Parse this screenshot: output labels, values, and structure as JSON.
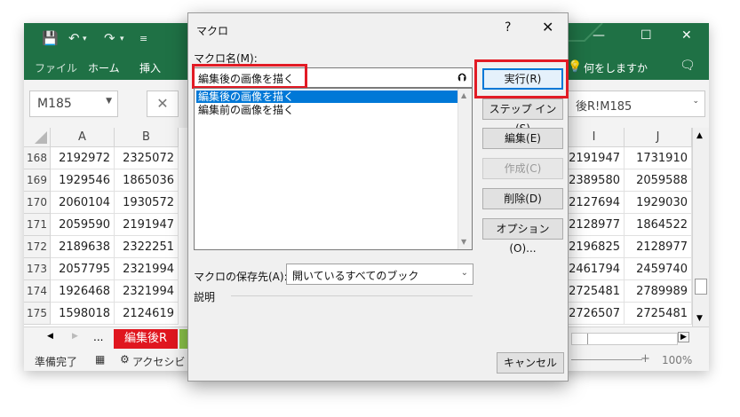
{
  "excel": {
    "ribbon_tabs": [
      "ファイル",
      "ホーム",
      "挿入"
    ],
    "tell_me": "何をしますか",
    "name_box": "M185",
    "formula_value": "後R!M185",
    "columns": [
      "A",
      "B",
      "I",
      "J"
    ],
    "rows": [
      {
        "num": "168",
        "a": "2192972",
        "b": "2325072",
        "i": "2191947",
        "j": "1731910"
      },
      {
        "num": "169",
        "a": "1929546",
        "b": "1865036",
        "i": "2389580",
        "j": "2059588"
      },
      {
        "num": "170",
        "a": "2060104",
        "b": "1930572",
        "i": "2127694",
        "j": "1929030"
      },
      {
        "num": "171",
        "a": "2059590",
        "b": "2191947",
        "i": "2128977",
        "j": "1864522"
      },
      {
        "num": "172",
        "a": "2189638",
        "b": "2322251",
        "i": "2196825",
        "j": "2128977"
      },
      {
        "num": "173",
        "a": "2057795",
        "b": "2321994",
        "i": "2461794",
        "j": "2459740"
      },
      {
        "num": "174",
        "a": "1926468",
        "b": "2321994",
        "i": "2725481",
        "j": "2789989"
      },
      {
        "num": "175",
        "a": "1598018",
        "b": "2124619",
        "i": "2726507",
        "j": "2725481"
      }
    ],
    "sheet_ellipsis": "...",
    "active_sheet": "編集後R",
    "status_ready": "準備完了",
    "status_accessibility": "アクセシビリ",
    "zoom": "100%",
    "accent_color": "#1f7145"
  },
  "dialog": {
    "title": "マクロ",
    "help": "?",
    "close": "✕",
    "macro_name_label": "マクロ名(M):",
    "macro_name_value": "編集後の画像を描く",
    "macros": [
      "編集後の画像を描く",
      "編集前の画像を描く"
    ],
    "save_location_label": "マクロの保存先(A):",
    "save_location_value": "開いているすべてのブック",
    "description_label": "説明",
    "buttons": {
      "run": "実行(R)",
      "step_in": "ステップ イン(S)",
      "edit": "編集(E)",
      "create": "作成(C)",
      "delete": "削除(D)",
      "options": "オプション(O)...",
      "cancel": "キャンセル"
    },
    "highlight_color": "#e21b25"
  }
}
